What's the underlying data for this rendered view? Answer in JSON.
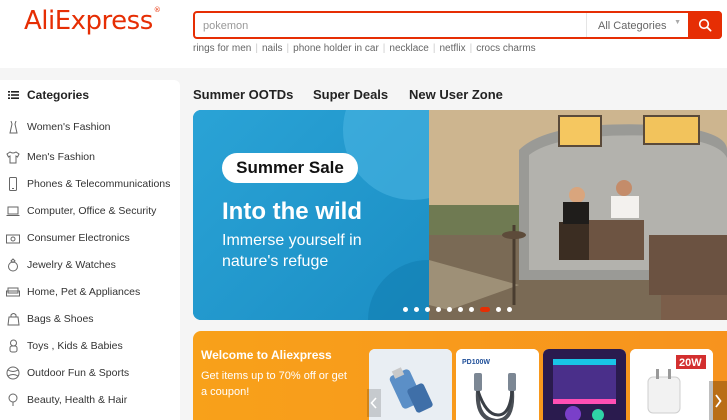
{
  "header": {
    "logo": "AliExpress",
    "logo_mark": "®",
    "search": {
      "value": "pokemon",
      "placeholder": ""
    },
    "category_select": "All Categories",
    "hot_words": [
      "rings for men",
      "nails",
      "phone holder in car",
      "necklace",
      "netflix",
      "crocs charms"
    ]
  },
  "sidebar": {
    "title": "Categories",
    "items": [
      {
        "label": "Women's Fashion",
        "icon": "dress-icon"
      },
      {
        "label": "Men's Fashion",
        "icon": "shirt-icon"
      },
      {
        "label": "Phones & Telecommunications",
        "icon": "phone-icon"
      },
      {
        "label": "Computer, Office & Security",
        "icon": "laptop-icon"
      },
      {
        "label": "Consumer Electronics",
        "icon": "camera-icon"
      },
      {
        "label": "Jewelry & Watches",
        "icon": "ring-icon"
      },
      {
        "label": "Home, Pet & Appliances",
        "icon": "sofa-icon"
      },
      {
        "label": "Bags & Shoes",
        "icon": "bag-icon"
      },
      {
        "label": "Toys , Kids & Babies",
        "icon": "toy-icon"
      },
      {
        "label": "Outdoor Fun & Sports",
        "icon": "ball-icon"
      },
      {
        "label": "Beauty, Health & Hair",
        "icon": "beauty-icon"
      }
    ]
  },
  "tabs": [
    "Summer OOTDs",
    "Super Deals",
    "New User Zone"
  ],
  "banner": {
    "badge": "Summer Sale",
    "headline": "Into the wild",
    "subline": "Immerse yourself in nature's refuge",
    "slide_count": 10,
    "active_slide": 8
  },
  "welcome": {
    "title": "Welcome to Aliexpress",
    "subtitle": "Get items up to 70% off or get a coupon!",
    "products": [
      {
        "label": "",
        "icon": "usb-adapter"
      },
      {
        "label": "PD100W",
        "icon": "usb-c-cable"
      },
      {
        "label": "",
        "icon": "led-strip"
      },
      {
        "label": "20W",
        "icon": "charger"
      }
    ]
  },
  "colors": {
    "brand": "#e62e04",
    "banner_blue": "#1f93c9",
    "welcome_orange": "#f7931e"
  }
}
